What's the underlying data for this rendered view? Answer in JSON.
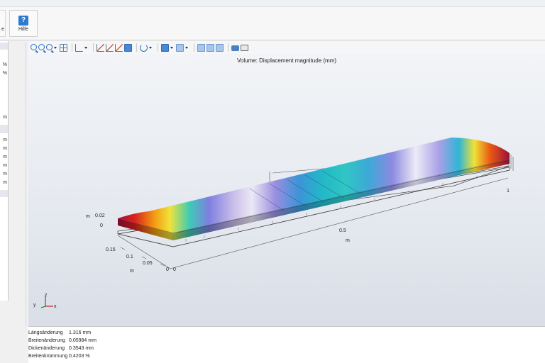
{
  "ribbon": {
    "left_button_label": "e",
    "help_button": {
      "label": "Hilfe",
      "icon": "help-icon",
      "glyph": "?"
    }
  },
  "left_panel": {
    "rows": [
      "%",
      "%",
      "m",
      "m",
      "m",
      "m",
      "m",
      "m",
      "m"
    ]
  },
  "graphics": {
    "toolbar_icons": [
      "zoom-in-icon",
      "zoom-out-icon",
      "zoom-box-icon",
      "zoom-extents-icon",
      "transparency-icon",
      "axes-orientation-icon",
      "plot-icon",
      "plot-icon",
      "plot-icon",
      "grid-toggle-icon",
      "rotate-icon",
      "view-icon",
      "scene-light-icon",
      "wireframe-icon",
      "render-icon",
      "render-icon",
      "camera-icon",
      "print-icon"
    ],
    "plot_title": "Volume: Displacement magnitude (mm)",
    "colormap": "rainbow",
    "axis_x": {
      "ticks": [
        "0",
        "0.5",
        "1"
      ],
      "unit": "m"
    },
    "axis_y": {
      "ticks": [
        "0",
        "0.05",
        "0.1",
        "0.15"
      ],
      "unit": "m"
    },
    "axis_z": {
      "ticks": [
        "0",
        "0.02"
      ],
      "unit": "m"
    },
    "triad": {
      "x": "x",
      "y": "y",
      "z": "z"
    }
  },
  "results": [
    {
      "label": "Längsänderung",
      "value": "1.316 mm"
    },
    {
      "label": "Breitenänderung",
      "value": "0.05984 mm"
    },
    {
      "label": "Dickenänderung",
      "value": "0.3543 mm"
    },
    {
      "label": "Breitenkrümmung",
      "value": "0.4203 %"
    }
  ]
}
